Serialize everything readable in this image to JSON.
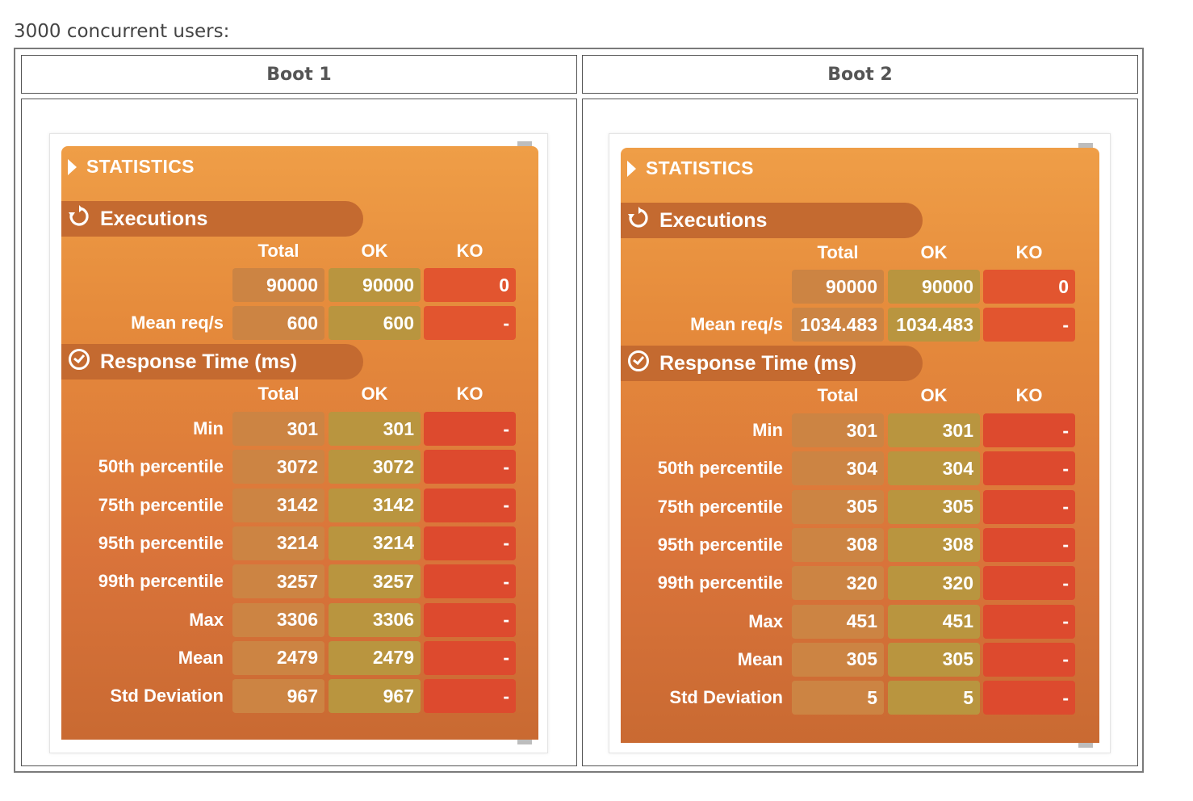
{
  "heading": "3000 concurrent users:",
  "columns": [
    {
      "header": "Boot 1",
      "statistics_title": "STATISTICS",
      "executions": {
        "title": "Executions",
        "col_headers": [
          "Total",
          "OK",
          "KO"
        ],
        "rows": [
          {
            "label": "",
            "total": "90000",
            "ok": "90000",
            "ko": "0"
          },
          {
            "label": "Mean req/s",
            "total": "600",
            "ok": "600",
            "ko": "-"
          }
        ]
      },
      "response_time": {
        "title": "Response Time (ms)",
        "col_headers": [
          "Total",
          "OK",
          "KO"
        ],
        "rows": [
          {
            "label": "Min",
            "total": "301",
            "ok": "301",
            "ko": "-"
          },
          {
            "label": "50th percentile",
            "total": "3072",
            "ok": "3072",
            "ko": "-"
          },
          {
            "label": "75th percentile",
            "total": "3142",
            "ok": "3142",
            "ko": "-"
          },
          {
            "label": "95th percentile",
            "total": "3214",
            "ok": "3214",
            "ko": "-"
          },
          {
            "label": "99th percentile",
            "total": "3257",
            "ok": "3257",
            "ko": "-"
          },
          {
            "label": "Max",
            "total": "3306",
            "ok": "3306",
            "ko": "-"
          },
          {
            "label": "Mean",
            "total": "2479",
            "ok": "2479",
            "ko": "-"
          },
          {
            "label": "Std Deviation",
            "total": "967",
            "ok": "967",
            "ko": "-"
          }
        ]
      }
    },
    {
      "header": "Boot 2",
      "statistics_title": "STATISTICS",
      "executions": {
        "title": "Executions",
        "col_headers": [
          "Total",
          "OK",
          "KO"
        ],
        "rows": [
          {
            "label": "",
            "total": "90000",
            "ok": "90000",
            "ko": "0"
          },
          {
            "label": "Mean req/s",
            "total": "1034.483",
            "ok": "1034.483",
            "ko": "-"
          }
        ]
      },
      "response_time": {
        "title": "Response Time (ms)",
        "col_headers": [
          "Total",
          "OK",
          "KO"
        ],
        "rows": [
          {
            "label": "Min",
            "total": "301",
            "ok": "301",
            "ko": "-"
          },
          {
            "label": "50th percentile",
            "total": "304",
            "ok": "304",
            "ko": "-"
          },
          {
            "label": "75th percentile",
            "total": "305",
            "ok": "305",
            "ko": "-"
          },
          {
            "label": "95th percentile",
            "total": "308",
            "ok": "308",
            "ko": "-"
          },
          {
            "label": "99th percentile",
            "total": "320",
            "ok": "320",
            "ko": "-"
          },
          {
            "label": "Max",
            "total": "451",
            "ok": "451",
            "ko": "-"
          },
          {
            "label": "Mean",
            "total": "305",
            "ok": "305",
            "ko": "-"
          },
          {
            "label": "Std Deviation",
            "total": "5",
            "ok": "5",
            "ko": "-"
          }
        ]
      }
    }
  ]
}
